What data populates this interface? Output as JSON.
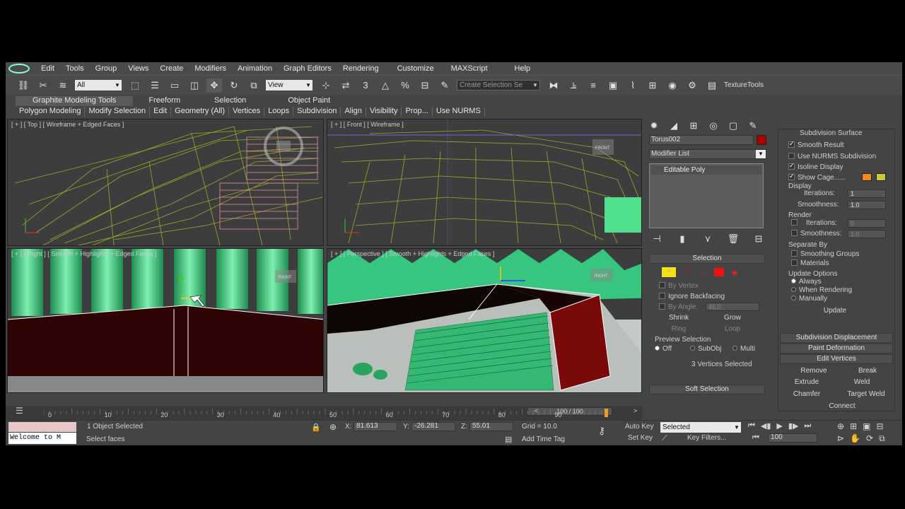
{
  "menu": {
    "items": [
      "Edit",
      "Tools",
      "Group",
      "Views",
      "Create",
      "Modifiers",
      "Animation",
      "Graph Editors",
      "Rendering",
      "Customize",
      "MAXScript",
      "Help"
    ]
  },
  "toolbar": {
    "filter_value": "All",
    "refcoord_value": "View",
    "snap_label": "3",
    "selection_set_placeholder": "Create Selection Se",
    "texture_tools": "TextureTools"
  },
  "ribbon": {
    "tabs": [
      "Graphite Modeling Tools",
      "Freeform",
      "Selection",
      "Object Paint"
    ],
    "panels": [
      "Polygon Modeling",
      "Modify Selection",
      "Edit",
      "Geometry (All)",
      "Vertices",
      "Loops",
      "Subdivision",
      "Align",
      "Visibility",
      "Prop...",
      "Use NURMS"
    ]
  },
  "viewports": {
    "top": {
      "label": "[ + ] [ Top ] [ Wireframe + Edged Faces ]"
    },
    "front": {
      "label": "[ + ] [ Front ] [ Wireframe ]",
      "cube": "FRONT"
    },
    "right": {
      "label": "[ + ] [ Right ] [ Smooth + Highlights + Edged Faces ]",
      "cube": "RIGHT"
    },
    "persp": {
      "label": "[ + ] [ Perspective ] [ Smooth + Highlights + Edged Faces ]",
      "cube": "RIGHT"
    }
  },
  "cmdpanel": {
    "object_name": "Torus002",
    "modifier_list": "Modifier List",
    "stack_item": "Editable Poly",
    "selection_title": "Selection",
    "by_vertex": "By Vertex",
    "ignore_backfacing": "Ignore Backfacing",
    "by_angle": "By Angle:",
    "angle_value": "45.0",
    "shrink": "Shrink",
    "grow": "Grow",
    "ring": "Ring",
    "loop": "Loop",
    "preview_title": "Preview Selection",
    "prev_off": "Off",
    "prev_subobj": "SubObj",
    "prev_multi": "Multi",
    "selected_count": "3 Vertices Selected",
    "soft_selection": "Soft Selection"
  },
  "subdiv": {
    "title": "Subdivision Surface",
    "smooth_result": "Smooth Result",
    "use_nurms": "Use NURMS Subdivision",
    "isoline": "Isoline Display",
    "show_cage": "Show Cage......",
    "display": "Display",
    "iterations": "Iterations:",
    "iter_value": "1",
    "smoothness": "Smoothness:",
    "smooth_value": "1.0",
    "render": "Render",
    "r_iter_value": "0",
    "r_smooth_value": "1.0",
    "separate_by": "Separate By",
    "smoothing_groups": "Smoothing Groups",
    "materials": "Materials",
    "update_options": "Update Options",
    "always": "Always",
    "when_rendering": "When Rendering",
    "manually": "Manually",
    "update": "Update",
    "subdiv_disp": "Subdivision Displacement",
    "paint_deform": "Paint Deformation",
    "edit_vertices": "Edit Vertices",
    "remove": "Remove",
    "break": "Break",
    "extrude": "Extrude",
    "weld": "Weld",
    "chamfer": "Chamfer",
    "target_weld": "Target Weld",
    "connect": "Connect",
    "cage_color1": "#f08a1c",
    "cage_color2": "#c9c93a"
  },
  "timeline": {
    "frame": "100 / 100",
    "ticks": [
      "0",
      "10",
      "20",
      "30",
      "40",
      "50",
      "60",
      "70",
      "80",
      "90"
    ],
    "progress": 1.0
  },
  "status": {
    "script_text": "Welcome to M",
    "objects_selected": "1 Object Selected",
    "prompt": "Select faces",
    "x_label": "X:",
    "x_value": "81.613",
    "y_label": "Y:",
    "y_value": "-26.281",
    "z_label": "Z:",
    "z_value": "55.01",
    "grid": "Grid = 10.0",
    "add_time_tag": "Add Time Tag",
    "auto_key": "Auto Key",
    "set_key": "Set Key",
    "selected": "Selected",
    "key_filters": "Key Filters...",
    "frame_value": "100"
  }
}
